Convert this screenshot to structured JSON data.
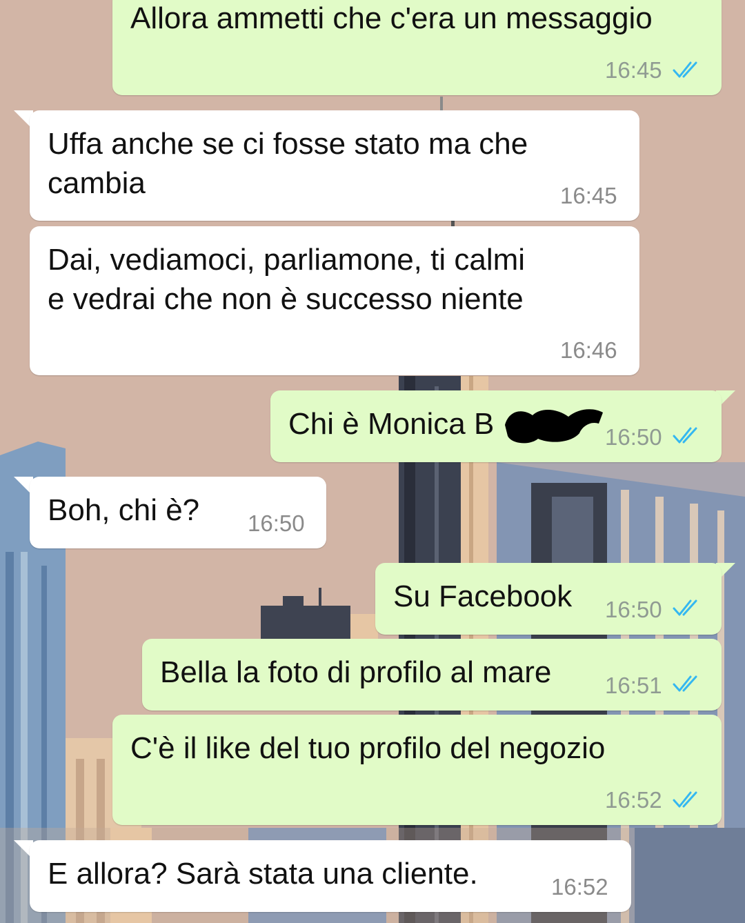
{
  "chat": {
    "messages": [
      {
        "direction": "out",
        "text": "Allora ammetti che c'era un messaggio",
        "time": "16:45",
        "status": "read"
      },
      {
        "direction": "in",
        "lines": [
          "Uffa anche se ci fosse stato ma che",
          "cambia"
        ],
        "time": "16:45"
      },
      {
        "direction": "in",
        "lines": [
          "Dai, vediamoci, parliamone, ti calmi",
          "e vedrai che non è successo niente"
        ],
        "time": "16:46"
      },
      {
        "direction": "out",
        "text": "Chi è Monica B",
        "time": "16:50",
        "status": "read",
        "redacted": true
      },
      {
        "direction": "in",
        "text": "Boh, chi è?",
        "time": "16:50"
      },
      {
        "direction": "out",
        "text": "Su Facebook",
        "time": "16:50",
        "status": "read"
      },
      {
        "direction": "out",
        "text": "Bella la foto di profilo al mare",
        "time": "16:51",
        "status": "read"
      },
      {
        "direction": "out",
        "text": "C'è il like del tuo profilo del negozio",
        "time": "16:52",
        "status": "read"
      },
      {
        "direction": "in",
        "text": "E allora? Sarà stata una cliente.",
        "time": "16:52"
      }
    ]
  },
  "icons": {
    "read_receipt": "double-check-icon",
    "read_receipt_color": "#34b7f1"
  },
  "colors": {
    "outgoing_bubble": "#e1fbc7",
    "incoming_bubble": "#ffffff",
    "wallpaper": "#d2b5a6"
  }
}
